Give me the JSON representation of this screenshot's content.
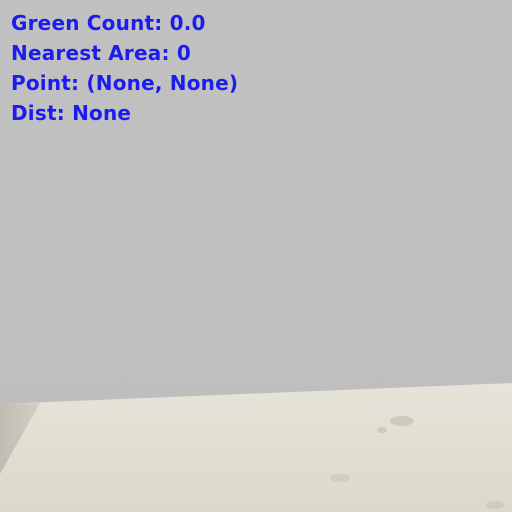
{
  "hud": {
    "green_count_label": "Green Count: 0.0",
    "nearest_area_label": "Nearest Area: 0",
    "point_label": "Point: (None, None)",
    "dist_label": "Dist: None",
    "text_color": "#1c1cf0"
  },
  "scene": {
    "wall_color": "#c0c0c0",
    "floor_color": "#e3e0d4"
  }
}
